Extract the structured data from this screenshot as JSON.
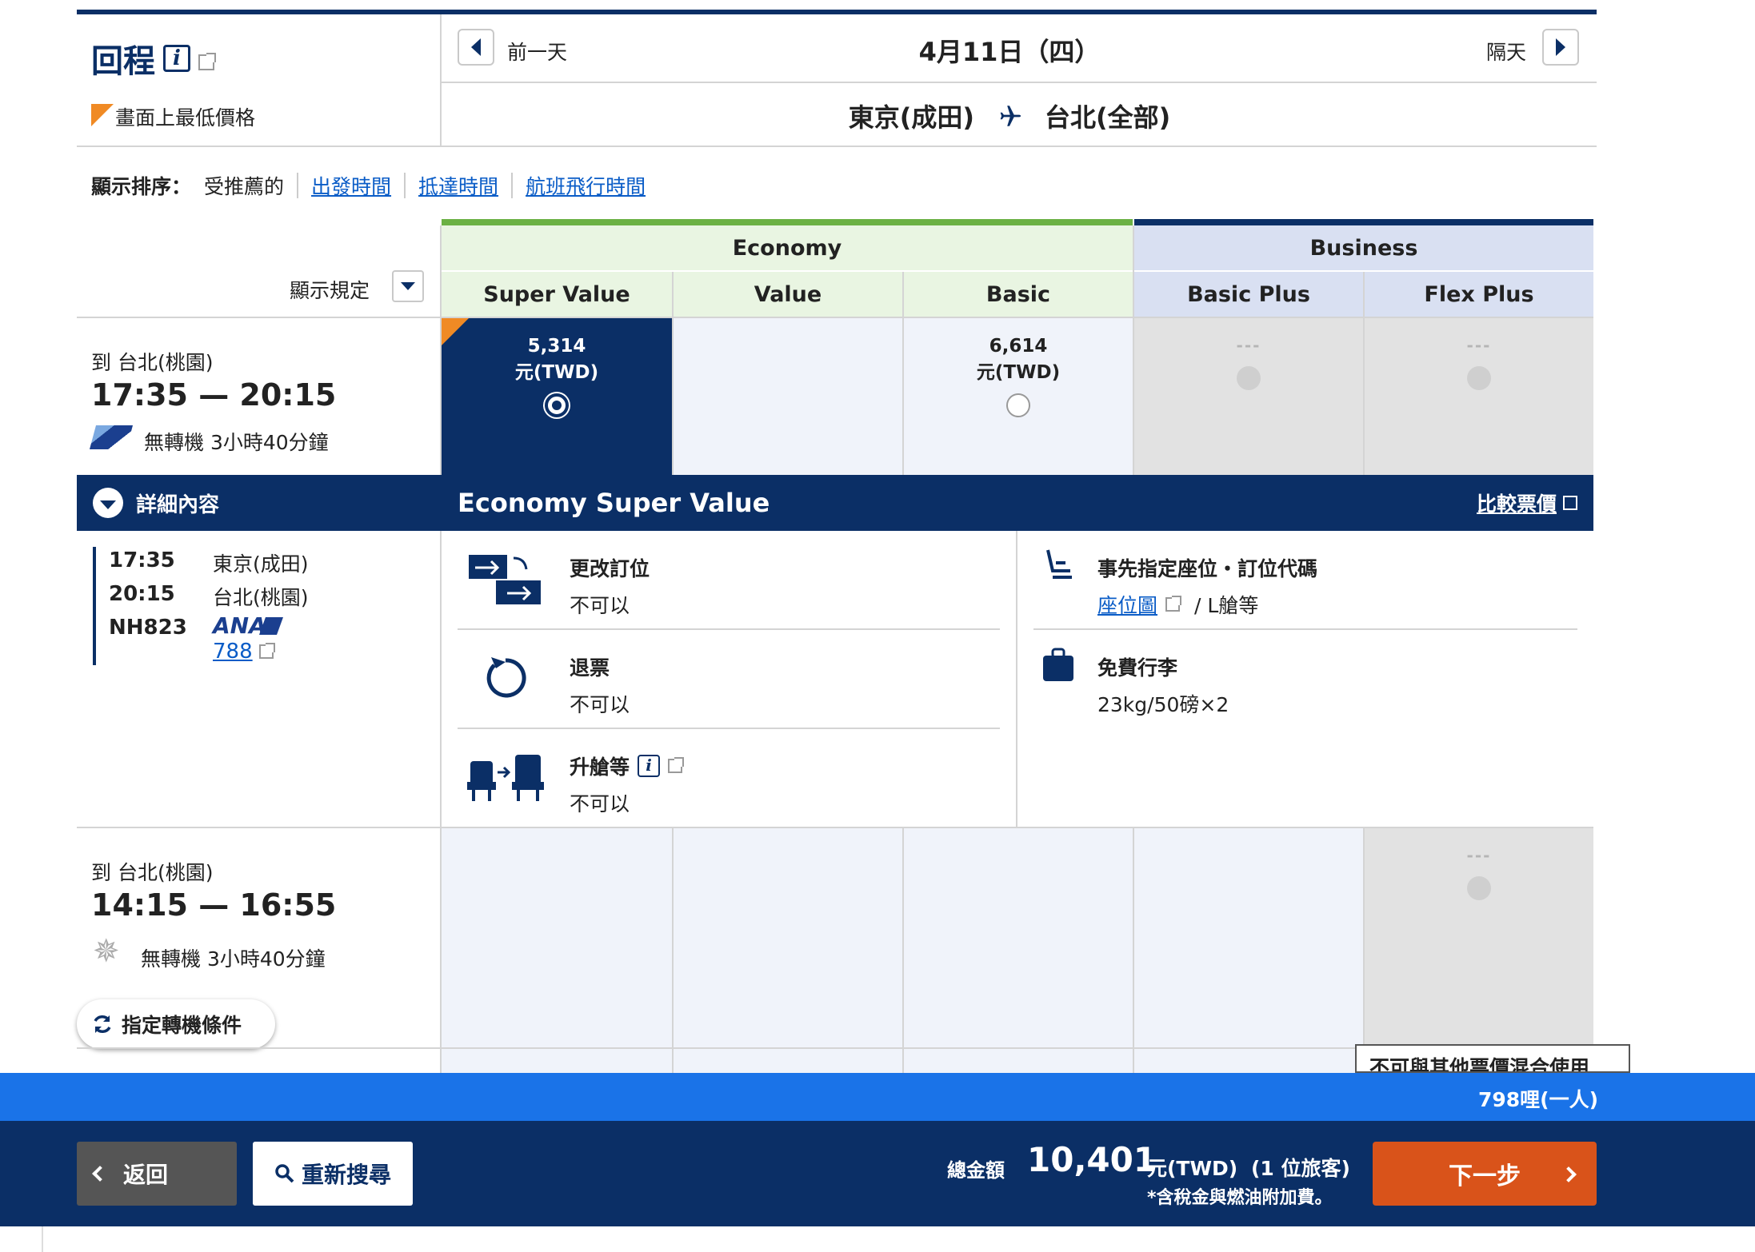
{
  "header": {
    "title": "回程",
    "lowest_price_label": "畫面上最低價格",
    "prev_day": "前一天",
    "date": "4月11日（四）",
    "next_day": "隔天",
    "origin": "東京(成田)",
    "destination": "台北(全部)"
  },
  "sort": {
    "label": "顯示排序：",
    "current": "受推薦的",
    "options": [
      "出發時間",
      "抵達時間",
      "航班飛行時間"
    ]
  },
  "rules_label": "顯示規定",
  "cabins": {
    "economy": "Economy",
    "business": "Business",
    "fare_types": [
      "Super Value",
      "Value",
      "Basic",
      "Basic Plus",
      "Flex Plus"
    ]
  },
  "flights": [
    {
      "to": "到 台北(桃園)",
      "time": "17:35 — 20:15",
      "info": "無轉機 3小時40分鐘",
      "fares": [
        {
          "price": "5,314",
          "unit": "元(TWD)"
        },
        {
          "price": "",
          "unit": ""
        },
        {
          "price": "6,614",
          "unit": "元(TWD)"
        },
        {
          "price": "---",
          "unit": ""
        },
        {
          "price": "---",
          "unit": ""
        }
      ]
    },
    {
      "to": "到 台北(桃園)",
      "time": "14:15 — 16:55",
      "info": "無轉機 3小時40分鐘",
      "fares": [
        {
          "price": "---",
          "unit": ""
        }
      ]
    }
  ],
  "details": {
    "toggle_label": "詳細內容",
    "selected_fare": "Economy Super Value",
    "compare_link": "比較票價",
    "segment": {
      "dep_time": "17:35",
      "dep_airport": "東京(成田)",
      "arr_time": "20:15",
      "arr_airport": "台北(桃園)",
      "flight_no": "NH823",
      "airline": "ANA",
      "aircraft": "788"
    },
    "features": {
      "change": {
        "title": "更改訂位",
        "value": "不可以"
      },
      "refund": {
        "title": "退票",
        "value": "不可以"
      },
      "upgrade": {
        "title": "升艙等",
        "value": "不可以"
      },
      "seat": {
        "title": "事先指定座位・訂位代碼",
        "link": "座位圖",
        "value": "/ L艙等"
      },
      "baggage": {
        "title": "免費行李",
        "value": "23kg/50磅×2"
      }
    }
  },
  "connection_button": "指定轉機條件",
  "tooltip": "不可與其他票價混合使用",
  "miles": "798哩(一人)",
  "footer": {
    "back": "返回",
    "research": "重新搜尋",
    "total_label": "總金額",
    "total": "10,401",
    "currency": "元(TWD)",
    "passengers": "(1 位旅客)",
    "tax_note": "*含稅金與燃油附加費。",
    "next": "下一步"
  },
  "colors": {
    "navy": "#0b2f66",
    "economy_green": "#6bb144",
    "economy_bg": "#e9f5e2",
    "business_bg": "#d9e0f2",
    "accent_orange": "#f08a24",
    "next_button": "#d9531a",
    "miles_strip": "#1a73e8"
  }
}
